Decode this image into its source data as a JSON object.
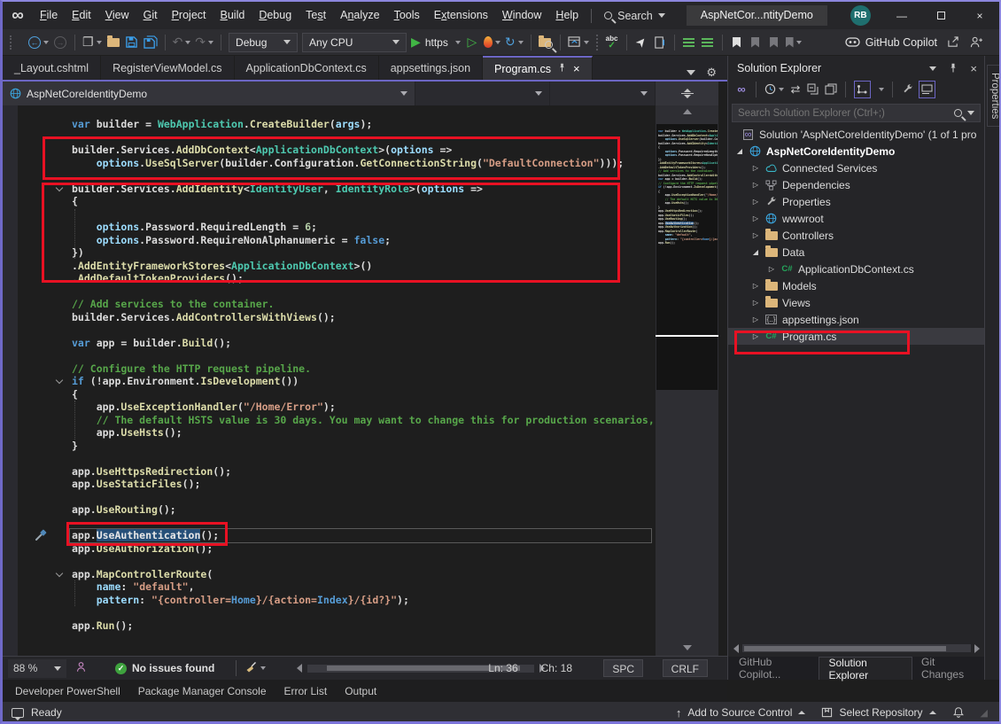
{
  "colors": {
    "accent_purple": "#6C66C4",
    "annotation_red": "#E81123",
    "selection_blue": "#264F78",
    "run_green": "#41B645"
  },
  "title_bar": {
    "menus": [
      {
        "label": "File",
        "key_index": 0
      },
      {
        "label": "Edit",
        "key_index": 0
      },
      {
        "label": "View",
        "key_index": 0
      },
      {
        "label": "Git",
        "key_index": 0
      },
      {
        "label": "Project",
        "key_index": 0
      },
      {
        "label": "Build",
        "key_index": 0
      },
      {
        "label": "Debug",
        "key_index": 0
      },
      {
        "label": "Test",
        "key_index": 2
      },
      {
        "label": "Analyze",
        "key_index": 1
      },
      {
        "label": "Tools",
        "key_index": 0
      },
      {
        "label": "Extensions",
        "key_index": 1
      },
      {
        "label": "Window",
        "key_index": 0
      },
      {
        "label": "Help",
        "key_index": 0
      }
    ],
    "search_label": "Search",
    "window_title": "AspNetCor...ntityDemo",
    "avatar_initials": "RB"
  },
  "toolbar": {
    "configuration": "Debug",
    "platform": "Any CPU",
    "run_profile": "https",
    "copilot_label": "GitHub Copilot"
  },
  "editor_tabs": [
    {
      "label": "_Layout.cshtml",
      "active": false
    },
    {
      "label": "RegisterViewModel.cs",
      "active": false
    },
    {
      "label": "ApplicationDbContext.cs",
      "active": false
    },
    {
      "label": "appsettings.json",
      "active": false
    },
    {
      "label": "Program.cs",
      "active": true
    }
  ],
  "breadcrumb": {
    "project": "AspNetCoreIdentityDemo"
  },
  "code": {
    "lines": [
      {
        "segs": [
          [
            "k",
            "var"
          ],
          [
            "p",
            " builder = "
          ],
          [
            "t",
            "WebApplication"
          ],
          [
            "p",
            "."
          ],
          [
            "m",
            "CreateBuilder"
          ],
          [
            "p",
            "("
          ],
          [
            "v",
            "args"
          ],
          [
            "p",
            ");"
          ]
        ]
      },
      {
        "segs": []
      },
      {
        "segs": [
          [
            "p",
            "builder.Services."
          ],
          [
            "m",
            "AddDbContext"
          ],
          [
            "p",
            "<"
          ],
          [
            "t",
            "ApplicationDbContext"
          ],
          [
            "p",
            ">("
          ],
          [
            "v",
            "options"
          ],
          [
            "p",
            " =>"
          ]
        ]
      },
      {
        "segs": [
          [
            "p",
            "    "
          ],
          [
            "v",
            "options"
          ],
          [
            "p",
            "."
          ],
          [
            "m",
            "UseSqlServer"
          ],
          [
            "p",
            "(builder.Configuration."
          ],
          [
            "m",
            "GetConnectionString"
          ],
          [
            "p",
            "("
          ],
          [
            "s",
            "\"DefaultConnection\""
          ],
          [
            "p",
            ")));"
          ]
        ]
      },
      {
        "segs": []
      },
      {
        "fold": true,
        "segs": [
          [
            "p",
            "builder.Services."
          ],
          [
            "m",
            "AddIdentity"
          ],
          [
            "p",
            "<"
          ],
          [
            "t",
            "IdentityUser"
          ],
          [
            "p",
            ", "
          ],
          [
            "t",
            "IdentityRole"
          ],
          [
            "p",
            ">("
          ],
          [
            "v",
            "options"
          ],
          [
            "p",
            " =>"
          ]
        ]
      },
      {
        "segs": [
          [
            "p",
            "{"
          ]
        ]
      },
      {
        "segs": []
      },
      {
        "segs": [
          [
            "p",
            "    "
          ],
          [
            "v",
            "options"
          ],
          [
            "p",
            ".Password.RequiredLength = "
          ],
          [
            "n",
            "6"
          ],
          [
            "p",
            ";"
          ]
        ]
      },
      {
        "segs": [
          [
            "p",
            "    "
          ],
          [
            "v",
            "options"
          ],
          [
            "p",
            ".Password.RequireNonAlphanumeric = "
          ],
          [
            "k",
            "false"
          ],
          [
            "p",
            ";"
          ]
        ]
      },
      {
        "segs": [
          [
            "p",
            "})"
          ]
        ]
      },
      {
        "segs": [
          [
            "p",
            "."
          ],
          [
            "m",
            "AddEntityFrameworkStores"
          ],
          [
            "p",
            "<"
          ],
          [
            "t",
            "ApplicationDbContext"
          ],
          [
            "p",
            ">()"
          ]
        ]
      },
      {
        "segs": [
          [
            "p",
            "."
          ],
          [
            "m",
            "AddDefaultTokenProviders"
          ],
          [
            "p",
            "();"
          ]
        ]
      },
      {
        "segs": []
      },
      {
        "segs": [
          [
            "c",
            "// Add services to the container."
          ]
        ]
      },
      {
        "segs": [
          [
            "p",
            "builder.Services."
          ],
          [
            "m",
            "AddControllersWithViews"
          ],
          [
            "p",
            "();"
          ]
        ]
      },
      {
        "segs": []
      },
      {
        "segs": [
          [
            "k",
            "var"
          ],
          [
            "p",
            " app = builder."
          ],
          [
            "m",
            "Build"
          ],
          [
            "p",
            "();"
          ]
        ]
      },
      {
        "segs": []
      },
      {
        "segs": [
          [
            "c",
            "// Configure the HTTP request pipeline."
          ]
        ]
      },
      {
        "fold": true,
        "segs": [
          [
            "k",
            "if"
          ],
          [
            "p",
            " (!app.Environment."
          ],
          [
            "m",
            "IsDevelopment"
          ],
          [
            "p",
            "())"
          ]
        ]
      },
      {
        "segs": [
          [
            "p",
            "{"
          ]
        ]
      },
      {
        "segs": [
          [
            "p",
            "    app."
          ],
          [
            "m",
            "UseExceptionHandler"
          ],
          [
            "p",
            "("
          ],
          [
            "s",
            "\"/Home/Error\""
          ],
          [
            "p",
            ");"
          ]
        ]
      },
      {
        "segs": [
          [
            "c",
            "    // The default HSTS value is 30 days. You may want to change this for production scenarios, see https://aka.ms/aspnetcore-hsts."
          ]
        ]
      },
      {
        "segs": [
          [
            "p",
            "    app."
          ],
          [
            "m",
            "UseHsts"
          ],
          [
            "p",
            "();"
          ]
        ]
      },
      {
        "segs": [
          [
            "p",
            "}"
          ]
        ]
      },
      {
        "segs": []
      },
      {
        "segs": [
          [
            "p",
            "app."
          ],
          [
            "m",
            "UseHttpsRedirection"
          ],
          [
            "p",
            "();"
          ]
        ]
      },
      {
        "segs": [
          [
            "p",
            "app."
          ],
          [
            "m",
            "UseStaticFiles"
          ],
          [
            "p",
            "();"
          ]
        ]
      },
      {
        "segs": []
      },
      {
        "segs": [
          [
            "p",
            "app."
          ],
          [
            "m",
            "UseRouting"
          ],
          [
            "p",
            "();"
          ]
        ]
      },
      {
        "segs": []
      },
      {
        "current": true,
        "segs": [
          [
            "p",
            "app."
          ],
          [
            "sel",
            "UseAuthentication"
          ],
          [
            "p",
            "();"
          ]
        ]
      },
      {
        "segs": [
          [
            "p",
            "app."
          ],
          [
            "m",
            "UseAuthorization"
          ],
          [
            "p",
            "();"
          ]
        ]
      },
      {
        "segs": []
      },
      {
        "fold": true,
        "segs": [
          [
            "p",
            "app."
          ],
          [
            "m",
            "MapControllerRoute"
          ],
          [
            "p",
            "("
          ]
        ]
      },
      {
        "segs": [
          [
            "p",
            "    "
          ],
          [
            "v",
            "name"
          ],
          [
            "p",
            ": "
          ],
          [
            "s",
            "\"default\""
          ],
          [
            "p",
            ","
          ]
        ]
      },
      {
        "segs": [
          [
            "p",
            "    "
          ],
          [
            "v",
            "pattern"
          ],
          [
            "p",
            ": "
          ],
          [
            "s",
            "\"{controller="
          ],
          [
            "kb",
            "Home"
          ],
          [
            "s",
            "}/{action="
          ],
          [
            "kb",
            "Index"
          ],
          [
            "s",
            "}/{id?}\""
          ],
          [
            "p",
            ");"
          ]
        ]
      },
      {
        "segs": []
      },
      {
        "segs": [
          [
            "p",
            "app."
          ],
          [
            "m",
            "Run"
          ],
          [
            "p",
            "();"
          ]
        ]
      }
    ]
  },
  "solution_explorer": {
    "title": "Solution Explorer",
    "search_placeholder": "Search Solution Explorer (Ctrl+;)",
    "tree": [
      {
        "icon": "solution",
        "label": "Solution 'AspNetCoreIdentityDemo' (1 of 1 pro",
        "indent": 0,
        "expander": "none",
        "bold": false,
        "selected": false
      },
      {
        "icon": "project",
        "label": "AspNetCoreIdentityDemo",
        "indent": 0,
        "expander": "expanded",
        "bold": true,
        "selected": false
      },
      {
        "icon": "cloud",
        "label": "Connected Services",
        "indent": 1,
        "expander": "collapsed",
        "bold": false,
        "selected": false
      },
      {
        "icon": "dependencies",
        "label": "Dependencies",
        "indent": 1,
        "expander": "collapsed",
        "bold": false,
        "selected": false
      },
      {
        "icon": "wrench-box",
        "label": "Properties",
        "indent": 1,
        "expander": "collapsed",
        "bold": false,
        "selected": false
      },
      {
        "icon": "globe",
        "label": "wwwroot",
        "indent": 1,
        "expander": "collapsed",
        "bold": false,
        "selected": false
      },
      {
        "icon": "folder",
        "label": "Controllers",
        "indent": 1,
        "expander": "collapsed",
        "bold": false,
        "selected": false
      },
      {
        "icon": "folder",
        "label": "Data",
        "indent": 1,
        "expander": "expanded",
        "bold": false,
        "selected": false
      },
      {
        "icon": "csharp",
        "label": "ApplicationDbContext.cs",
        "indent": 2,
        "expander": "collapsed",
        "bold": false,
        "selected": false
      },
      {
        "icon": "folder",
        "label": "Models",
        "indent": 1,
        "expander": "collapsed",
        "bold": false,
        "selected": false
      },
      {
        "icon": "folder",
        "label": "Views",
        "indent": 1,
        "expander": "collapsed",
        "bold": false,
        "selected": false
      },
      {
        "icon": "json",
        "label": "appsettings.json",
        "indent": 1,
        "expander": "collapsed",
        "bold": false,
        "selected": false
      },
      {
        "icon": "csharp",
        "label": "Program.cs",
        "indent": 1,
        "expander": "collapsed",
        "bold": false,
        "selected": true
      }
    ],
    "panel_tabs": [
      {
        "label": "GitHub Copilot...",
        "active": false
      },
      {
        "label": "Solution Explorer",
        "active": true
      },
      {
        "label": "Git Changes",
        "active": false
      }
    ]
  },
  "right_strip": {
    "properties_label": "Properties"
  },
  "editor_status": {
    "zoom_level": "88 %",
    "issues_message": "No issues found",
    "line": "Ln: 36",
    "column": "Ch: 18",
    "spaces_label": "SPC",
    "line_ending": "CRLF"
  },
  "bottom_panel_tabs": [
    {
      "label": "Developer PowerShell"
    },
    {
      "label": "Package Manager Console"
    },
    {
      "label": "Error List"
    },
    {
      "label": "Output"
    }
  ],
  "status_bar": {
    "message": "Ready",
    "add_to_source_control": "Add to Source Control",
    "select_repository": "Select Repository"
  }
}
